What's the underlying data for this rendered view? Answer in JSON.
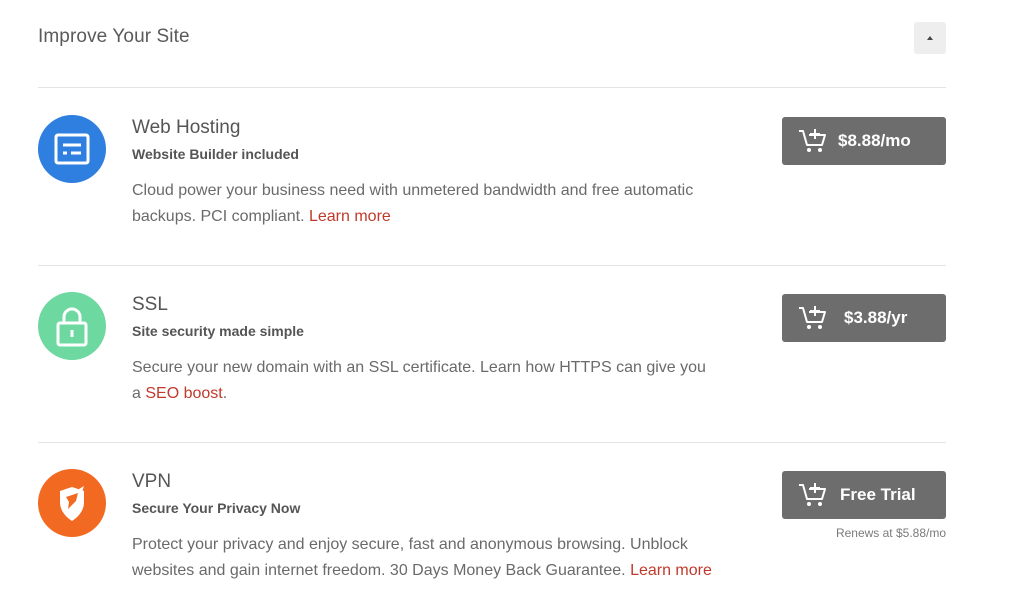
{
  "section": {
    "title": "Improve Your Site",
    "collapse_icon": "caret-up-icon"
  },
  "products": [
    {
      "title": "Web Hosting",
      "subtitle": "Website Builder included",
      "description": "Cloud power your business need with unmetered bandwidth and free automatic backups. PCI compliant.",
      "link_text": "Learn more",
      "link_prefix": "",
      "price_label": "$8.88/mo",
      "icon": "hosting-server-icon",
      "icon_color": "#2f7fe0"
    },
    {
      "title": "SSL",
      "subtitle": "Site security made simple",
      "description": "Secure your new domain with an SSL certificate. Learn how HTTPS can give you a",
      "link_text": "SEO boost",
      "link_suffix": ".",
      "price_label": "$3.88/yr",
      "icon": "padlock-icon",
      "icon_color": "#6dd8a0"
    },
    {
      "title": "VPN",
      "subtitle": "Secure Your Privacy Now",
      "description": "Protect your privacy and enjoy secure, fast and anonymous browsing. Unblock websites and gain internet freedom. 30 Days Money Back Guarantee.",
      "link_text": "Learn more",
      "price_label": "Free Trial",
      "renews_text": "Renews at $5.88/mo",
      "icon": "vpn-shield-icon",
      "icon_color": "#f26a21"
    }
  ],
  "colors": {
    "button_bg": "#6d6d6d",
    "link": "#c0392b",
    "divider": "#e4e4e4"
  }
}
